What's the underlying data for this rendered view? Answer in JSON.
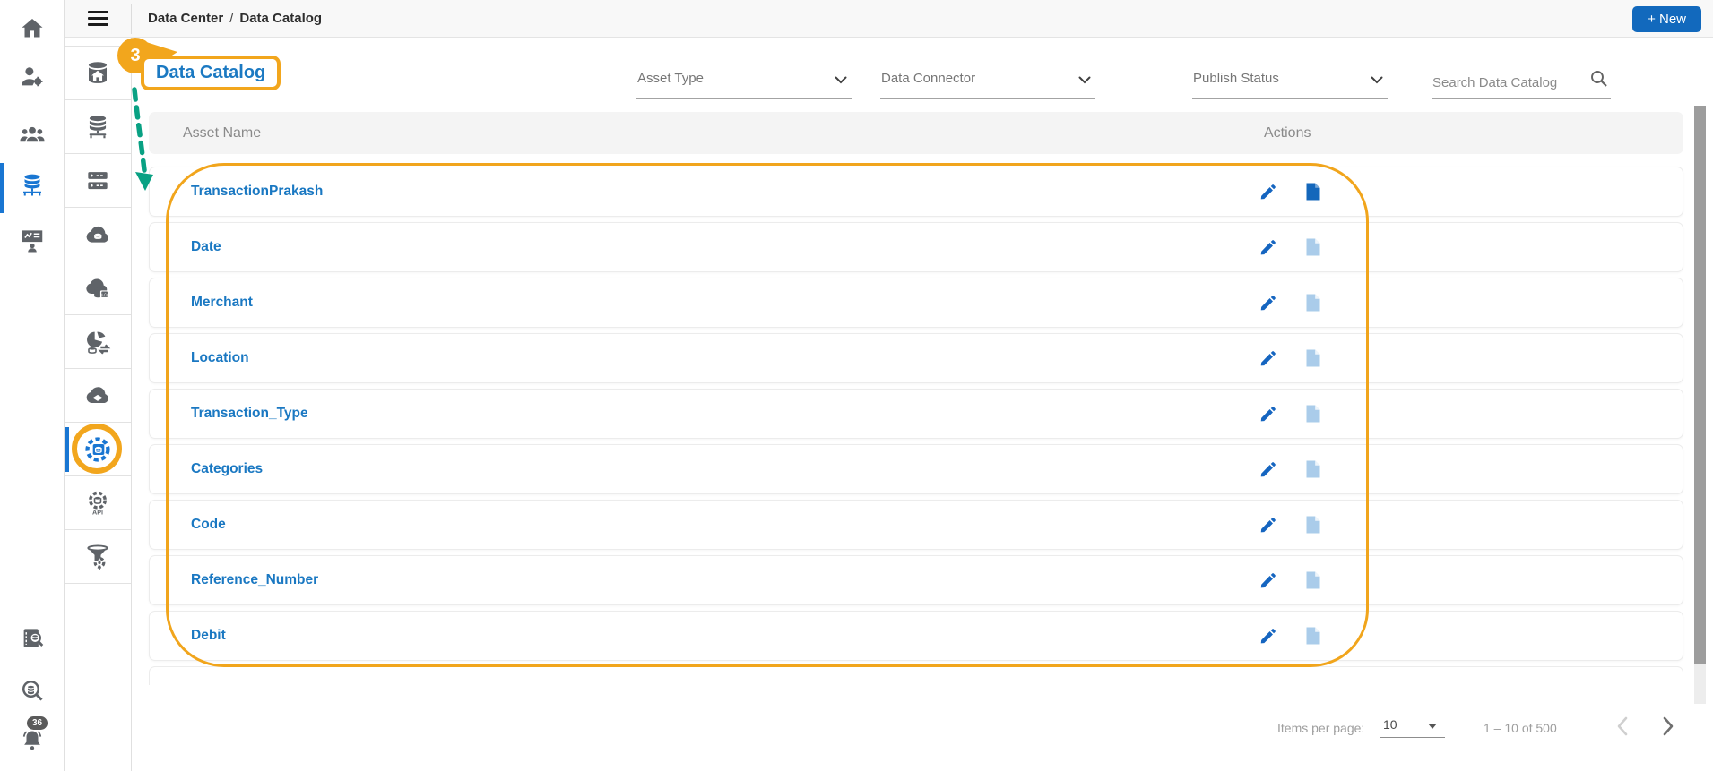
{
  "topbar": {
    "breadcrumb": {
      "items": [
        "Data Center",
        "Data Catalog"
      ],
      "separator": "/"
    },
    "new_button_label": "+ New"
  },
  "page_title": "Data Catalog",
  "filters": {
    "asset_type": "Asset Type",
    "data_connector": "Data Connector",
    "publish_status": "Publish Status"
  },
  "search": {
    "placeholder": "Search Data Catalog"
  },
  "table": {
    "headers": {
      "asset_name": "Asset Name",
      "actions": "Actions"
    },
    "rows": [
      {
        "name": "TransactionPrakash"
      },
      {
        "name": "Date"
      },
      {
        "name": "Merchant"
      },
      {
        "name": "Location"
      },
      {
        "name": "Transaction_Type"
      },
      {
        "name": "Categories"
      },
      {
        "name": "Code"
      },
      {
        "name": "Reference_Number"
      },
      {
        "name": "Debit"
      }
    ]
  },
  "pagination": {
    "items_per_page_label": "Items per page:",
    "items_per_page": "10",
    "range": "1 – 10 of 500"
  },
  "annotation": {
    "step": "3"
  },
  "sidebar": {
    "notification_count": "36",
    "api_label": "API"
  },
  "colors": {
    "accent_orange": "#f2a61d",
    "arrow_green": "#09a183",
    "link_blue": "#1a78c2",
    "button_blue": "#1269bd",
    "active_blue": "#1976d2",
    "light_file_blue": "#aaccea"
  }
}
